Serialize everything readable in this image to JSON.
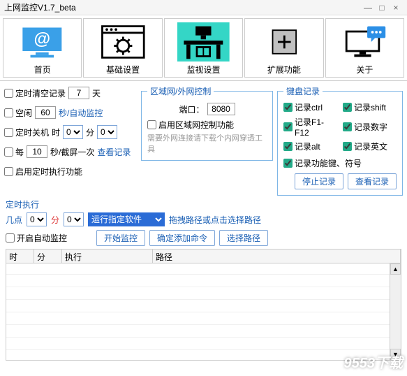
{
  "window": {
    "title": "上网监控V1.7_beta",
    "min": "—",
    "max": "□",
    "close": "×"
  },
  "toolbar": {
    "items": [
      {
        "label": "首页"
      },
      {
        "label": "基础设置"
      },
      {
        "label": "监视设置"
      },
      {
        "label": "扩展功能"
      },
      {
        "label": "关于"
      }
    ]
  },
  "left": {
    "clear_records": "定时清空记录",
    "clear_val": "7",
    "clear_unit": "天",
    "idle": "空闲",
    "idle_val": "60",
    "idle_unit": "秒/自动监控",
    "shutdown": "定时关机",
    "shutdown_h": "时",
    "shutdown_hv": "0",
    "shutdown_m": "分",
    "shutdown_mv": "0",
    "every": "每",
    "every_val": "10",
    "every_unit": "秒/截屏一次",
    "view": "查看记录",
    "enable_sched": "启用定时执行功能"
  },
  "lan": {
    "legend": "区域网/外网控制",
    "port_lbl": "端口：",
    "port_val": "8080",
    "enable": "启用区域网控制功能",
    "hint": "需要外网连接请下载个内网穿透工具"
  },
  "kb": {
    "legend": "键盘记录",
    "items": [
      "记录ctrl",
      "记录shift",
      "记录F1-F12",
      "记录数字",
      "记录alt",
      "记录英文"
    ],
    "special": "记录功能键、符号",
    "stop": "停止记录",
    "view": "查看记录"
  },
  "sched": {
    "title": "定时执行",
    "points": "几点",
    "p1": "0",
    "mid": "分",
    "p2": "0",
    "run": "运行指定软件",
    "drag": "拖拽路径或点击选择路径",
    "auto": "开启自动监控",
    "start": "开始监控",
    "confirm": "确定添加命令",
    "choose": "选择路径"
  },
  "grid": {
    "h1": "时",
    "h2": "分",
    "h3": "执行",
    "h4": "路径"
  },
  "watermark": "9553下载"
}
